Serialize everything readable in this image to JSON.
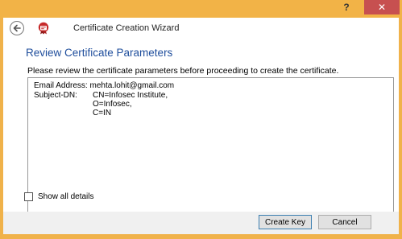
{
  "window": {
    "help_label": "?",
    "close_label": "✕",
    "colors": {
      "frame": "#f2b347",
      "close": "#c75050",
      "title_blue": "#1f4e9c"
    }
  },
  "header": {
    "title": "Certificate Creation Wizard",
    "back_icon": "back-arrow-icon",
    "app_icon": "certificate-app-icon"
  },
  "page": {
    "section_title": "Review Certificate Parameters",
    "instructions": "Please review the certificate parameters before proceeding to create the certificate."
  },
  "params": {
    "email_label": "Email Address:",
    "email_value": "mehta.lohit@gmail.com",
    "subject_label": "Subject-DN:",
    "subject_lines": [
      "CN=Infosec Institute,",
      "O=Infosec,",
      "C=IN"
    ]
  },
  "options": {
    "show_all_details_label": "Show all details",
    "show_all_details_checked": false
  },
  "footer": {
    "create_key_label": "Create Key",
    "cancel_label": "Cancel"
  }
}
